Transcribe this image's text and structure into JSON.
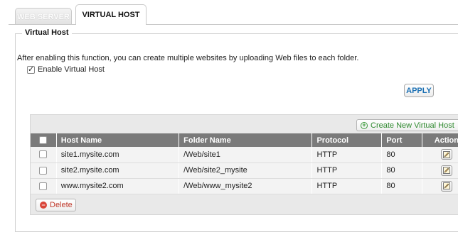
{
  "tabs": [
    {
      "label": "WEB SERVER",
      "active": false
    },
    {
      "label": "VIRTUAL HOST",
      "active": true
    }
  ],
  "section": {
    "legend": "Virtual Host",
    "description": "After enabling this function, you can create multiple websites by uploading Web files to each folder.",
    "enable_label": "Enable Virtual Host",
    "enable_checked": true,
    "apply_label": "APPLY"
  },
  "table": {
    "create_label": "Create New Virtual Host",
    "delete_label": "Delete",
    "headers": {
      "host": "Host Name",
      "folder": "Folder Name",
      "protocol": "Protocol",
      "port": "Port",
      "action": "Action"
    },
    "rows": [
      {
        "host": "site1.mysite.com",
        "folder": "/Web/site1",
        "protocol": "HTTP",
        "port": "80"
      },
      {
        "host": "site2.mysite.com",
        "folder": "/Web/site2_mysite",
        "protocol": "HTTP",
        "port": "80"
      },
      {
        "host": "www.mysite2.com",
        "folder": "/Web/www_mysite2",
        "protocol": "HTTP",
        "port": "80"
      }
    ]
  },
  "icons": {
    "create": "plus-circle-icon",
    "delete": "minus-circle-icon",
    "edit": "pencil-edit-icon",
    "checkbox": "checkbox-icon"
  },
  "colors": {
    "header_bg": "#7a7a7a",
    "apply_text": "#1a6fb3",
    "create_text": "#2f8a2f",
    "delete_text": "#c0392b"
  }
}
